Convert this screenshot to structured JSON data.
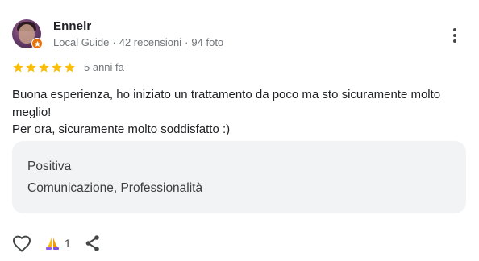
{
  "reviewer": {
    "name": "Ennelr",
    "badge": "Local Guide",
    "reviews": "42 recensioni",
    "photos": "94 foto",
    "separator": "·"
  },
  "rating": {
    "stars": 5,
    "max": 5,
    "star_color": "#fbbc04",
    "time": "5 anni fa"
  },
  "review": {
    "line1": "Buona esperienza, ho iniziato un trattamento da poco ma sto sicuramente molto meglio!",
    "line2": "Per ora, sicuramente molto soddisfatto :)"
  },
  "sentiment": {
    "label": "Positiva",
    "topics": "Comunicazione, Professionalità"
  },
  "actions": {
    "thanks_count": "1",
    "icons": [
      "heart-icon",
      "thanks-icon",
      "share-icon",
      "more-vert-icon"
    ]
  },
  "colors": {
    "badge": "#e8710a",
    "box_bg": "#f1f3f4",
    "meta_text": "#70757a"
  }
}
